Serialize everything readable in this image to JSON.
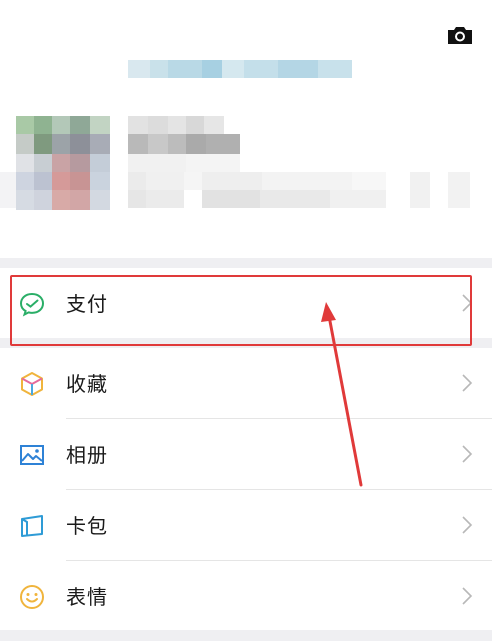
{
  "profile": {
    "camera_icon": "camera-icon"
  },
  "menu": {
    "items": [
      {
        "label": "支付",
        "icon": "wallet-icon",
        "color": "#2aae67"
      },
      {
        "label": "收藏",
        "icon": "cube-icon",
        "color": "#f0b43c"
      },
      {
        "label": "相册",
        "icon": "image-icon",
        "color": "#2e82d6"
      },
      {
        "label": "卡包",
        "icon": "card-icon",
        "color": "#2e9bd6"
      },
      {
        "label": "表情",
        "icon": "smile-icon",
        "color": "#f0b43c"
      }
    ]
  },
  "annotation": {
    "highlight_color": "#e03a3a"
  }
}
